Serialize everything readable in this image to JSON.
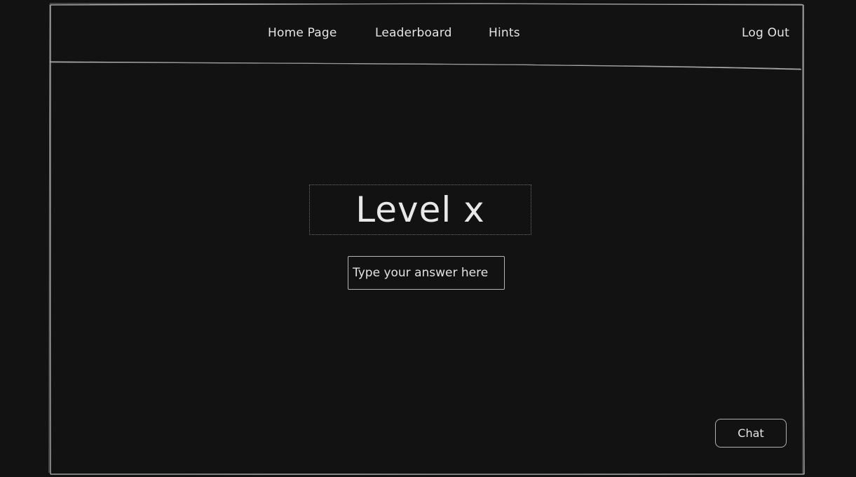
{
  "nav": {
    "items": [
      {
        "label": "Home Page"
      },
      {
        "label": "Leaderboard"
      },
      {
        "label": "Hints"
      }
    ],
    "logout_label": "Log Out"
  },
  "main": {
    "level_title": "Level x",
    "answer_input": {
      "value": "",
      "placeholder": "Type your answer here"
    }
  },
  "chat": {
    "label": "Chat"
  },
  "colors": {
    "background": "#121212",
    "stroke": "#b8b8b8",
    "text": "#e6e6e6"
  }
}
